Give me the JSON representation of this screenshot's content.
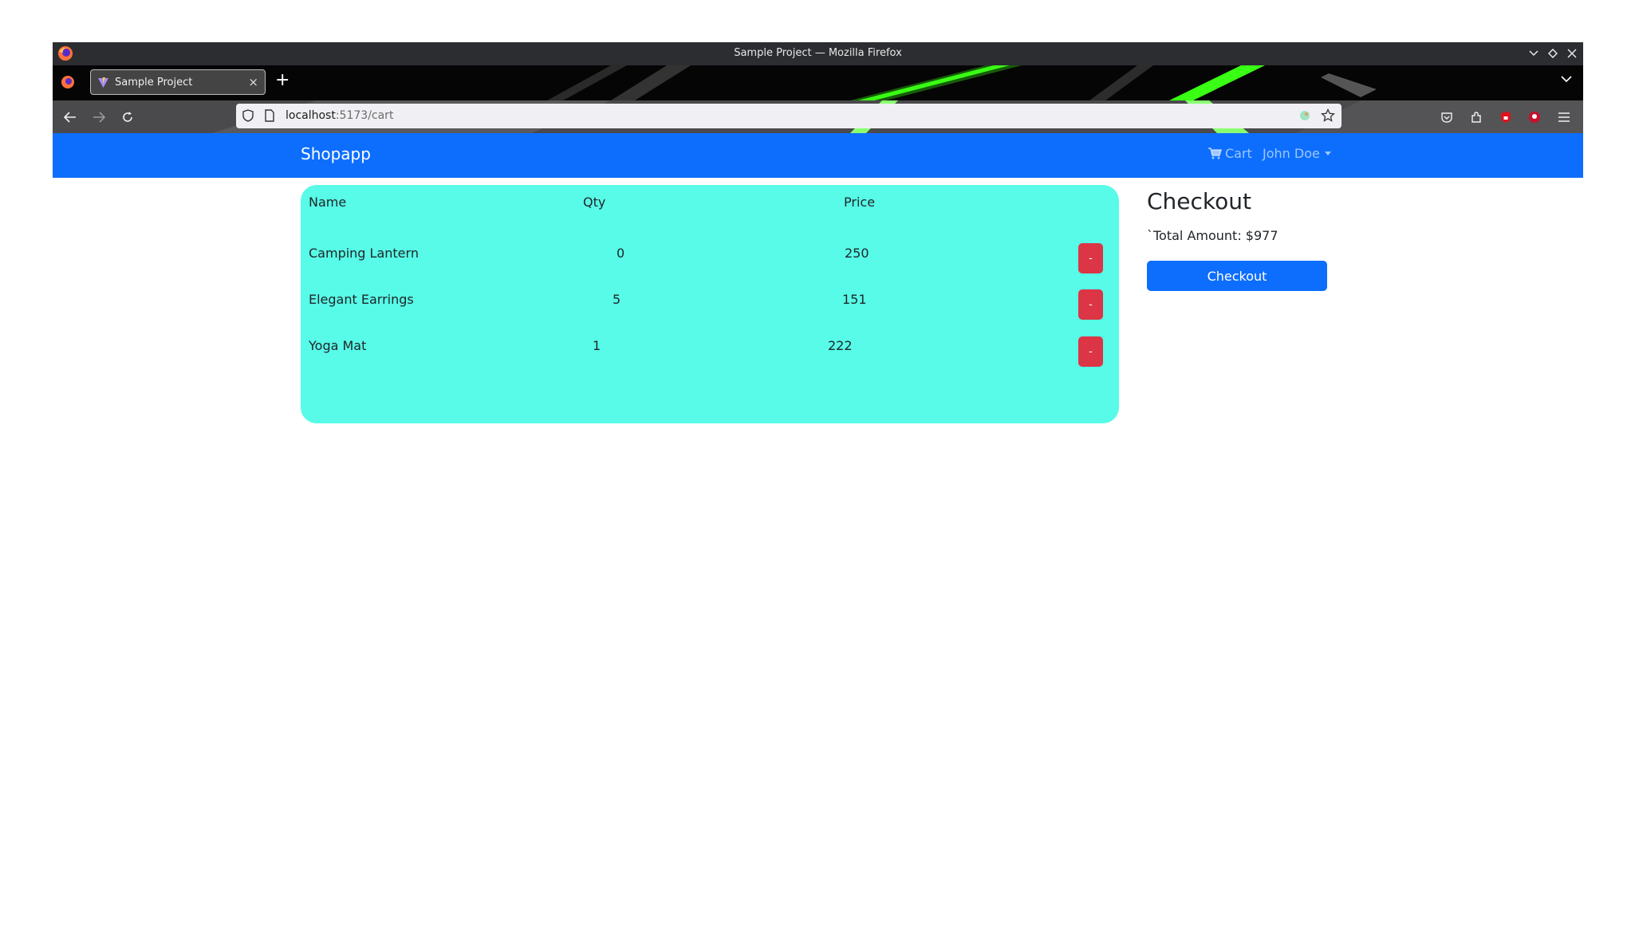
{
  "window": {
    "title": "Sample Project — Mozilla Firefox"
  },
  "tabs": [
    {
      "label": "Sample Project",
      "close": "×"
    }
  ],
  "newtab": "+",
  "urlbar": {
    "host": "localhost",
    "path": ":5173/cart"
  },
  "app": {
    "brand": "Shopapp",
    "nav": {
      "cart": "Cart",
      "user": "John Doe"
    }
  },
  "cart": {
    "headers": {
      "name": "Name",
      "qty": "Qty",
      "price": "Price"
    },
    "rows": [
      {
        "name": "Camping Lantern",
        "qty": "0",
        "price": "250",
        "remove": "-"
      },
      {
        "name": "Elegant Earrings",
        "qty": "5",
        "price": "151",
        "remove": "-"
      },
      {
        "name": "Yoga Mat",
        "qty": "1",
        "price": "222",
        "remove": "-"
      }
    ]
  },
  "checkout": {
    "title": "Checkout",
    "total": "`Total Amount: $977",
    "button": "Checkout"
  },
  "colors": {
    "navbar": "#0d6efd",
    "cart_panel": "#57fbe8",
    "remove_button": "#dc3545",
    "checkout_button": "#0d6efd"
  }
}
